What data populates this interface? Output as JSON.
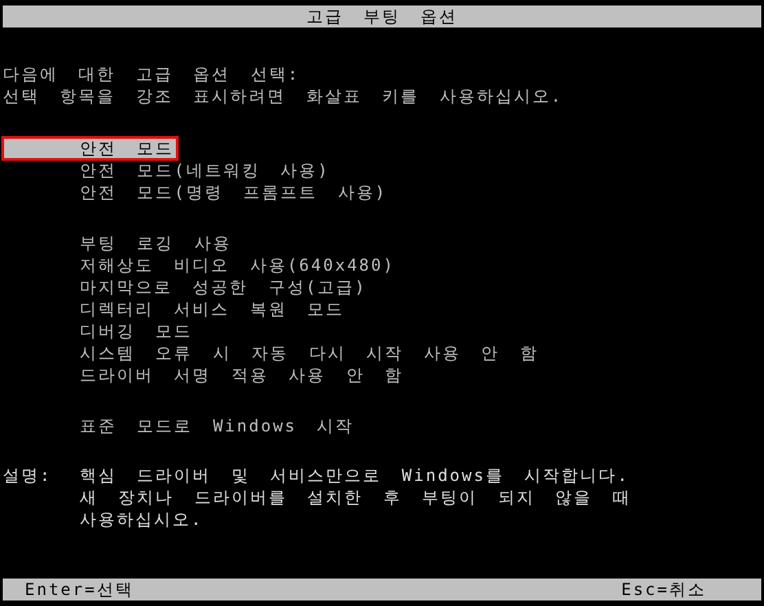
{
  "title": "고급 부팅 옵션",
  "instructions": [
    "다음에 대한 고급 옵션 선택:",
    "선택 항목을 강조 표시하려면 화살표 키를 사용하십시오."
  ],
  "option_groups": [
    [
      {
        "label": "안전 모드",
        "selected": true
      },
      {
        "label": "안전 모드(네트워킹 사용)",
        "selected": false
      },
      {
        "label": "안전 모드(명령 프롬프트 사용)",
        "selected": false
      }
    ],
    [
      {
        "label": "부팅 로깅 사용",
        "selected": false
      },
      {
        "label": "저해상도 비디오 사용(640x480)",
        "selected": false
      },
      {
        "label": "마지막으로 성공한 구성(고급)",
        "selected": false
      },
      {
        "label": "디렉터리 서비스 복원 모드",
        "selected": false
      },
      {
        "label": "디버깅 모드",
        "selected": false
      },
      {
        "label": "시스템 오류 시 자동 다시 시작 사용 안 함",
        "selected": false
      },
      {
        "label": "드라이버 서명 적용 사용 안 함",
        "selected": false
      }
    ],
    [
      {
        "label": "표준 모드로 Windows 시작",
        "selected": false
      }
    ]
  ],
  "description": {
    "label": "설명:",
    "lines": [
      "핵심 드라이버 및 서비스만으로 Windows를 시작합니다.",
      "새 장치나 드라이버를 설치한 후 부팅이 되지 않을 때",
      "사용하십시오."
    ]
  },
  "footer": {
    "left": "Enter=선택",
    "right": "Esc=취소"
  }
}
